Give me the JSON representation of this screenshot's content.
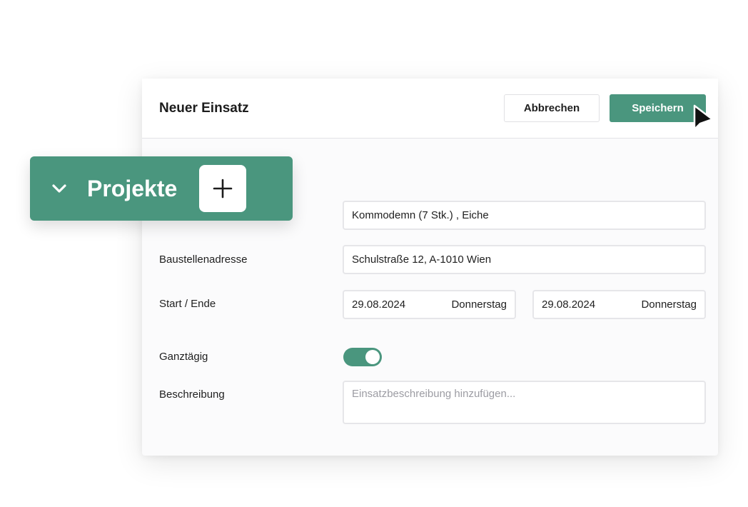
{
  "dialog": {
    "title": "Neuer Einsatz",
    "cancel_label": "Abbrechen",
    "save_label": "Speichern"
  },
  "projekte": {
    "label": "Projekte",
    "chevron_icon": "chevron-down-icon",
    "add_icon": "plus-icon"
  },
  "form": {
    "item_value": "Kommodemn (7 Stk.) , Eiche",
    "address_label": "Baustellenadresse",
    "address_value": "Schulstraße 12, A-1010 Wien",
    "start_end_label": "Start / Ende",
    "start_date": "29.08.2024",
    "start_day": "Donnerstag",
    "end_date": "29.08.2024",
    "end_day": "Donnerstag",
    "allday_label": "Ganztägig",
    "allday_on": true,
    "description_label": "Beschreibung",
    "description_placeholder": "Einsatzbeschreibung hinzufügen..."
  },
  "colors": {
    "accent": "#4a967e",
    "border": "#e6e6e9",
    "placeholder": "#9c9ca3"
  }
}
